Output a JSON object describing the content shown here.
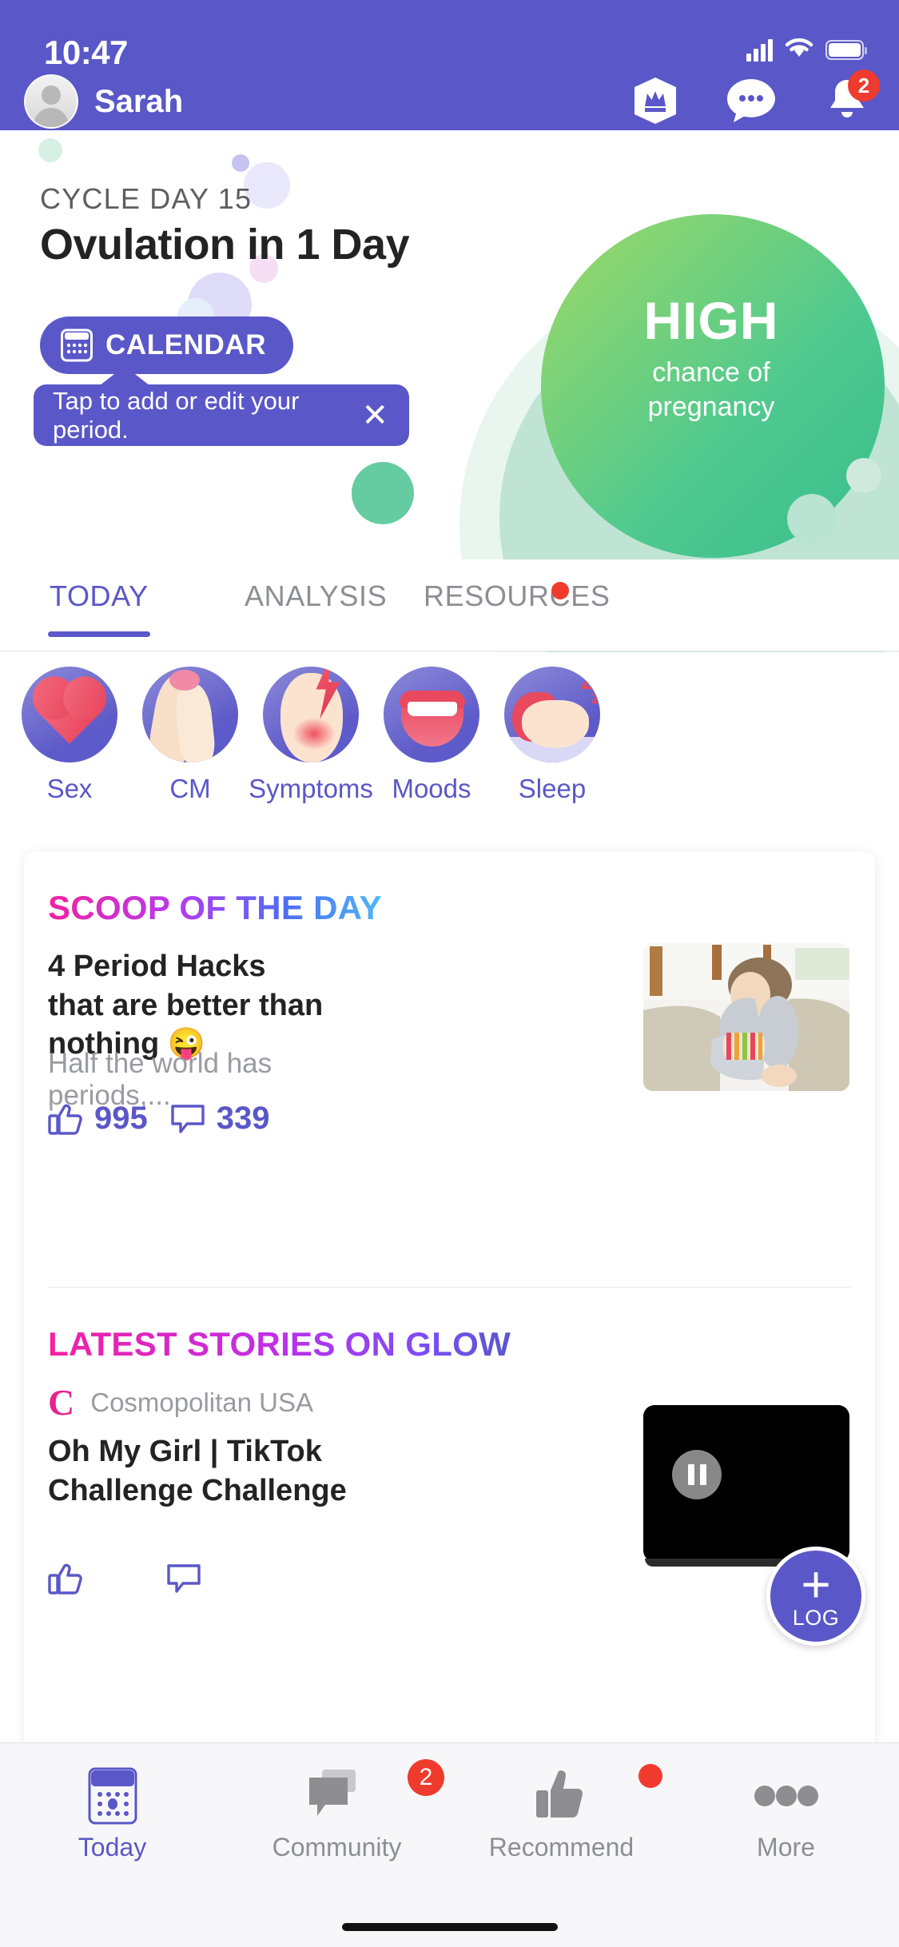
{
  "status_bar": {
    "time": "10:47"
  },
  "header": {
    "username": "Sarah",
    "icons": [
      {
        "name": "premium-crown-icon"
      },
      {
        "name": "messages-icon"
      },
      {
        "name": "notifications-bell-icon",
        "badge": "2"
      }
    ]
  },
  "hero": {
    "cycle_day": "CYCLE DAY 15",
    "ovulation": "Ovulation in 1 Day",
    "chance_level": "HIGH",
    "chance_label_line1": "chance of",
    "chance_label_line2": "pregnancy",
    "calendar_button": "CALENDAR",
    "tooltip": "Tap to add or edit your period.",
    "tooltip_close": "✕",
    "green": "#4fc98f",
    "accent": "#5a57c8"
  },
  "tabs": [
    {
      "label": "TODAY",
      "active": true
    },
    {
      "label": "ANALYSIS",
      "active": false
    },
    {
      "label": "RESOURCES",
      "active": false,
      "has_dot": true
    }
  ],
  "trackers": [
    {
      "label": "Sex",
      "icon": "heart-icon"
    },
    {
      "label": "CM",
      "icon": "cervical-mucus-icon"
    },
    {
      "label": "Symptoms",
      "icon": "symptoms-bolt-icon"
    },
    {
      "label": "Moods",
      "icon": "mouth-icon"
    },
    {
      "label": "Sleep",
      "icon": "sleeping-face-icon"
    }
  ],
  "scoop": {
    "section_title": "SCOOP OF THE DAY",
    "headline": "4 Period Hacks that are better than nothing 😜",
    "subtext": "Half the world has periods,...",
    "likes": "995",
    "comments": "339"
  },
  "latest": {
    "section_title": "LATEST STORIES ON GLOW",
    "source_logo": "C",
    "source_name": "Cosmopolitan USA",
    "headline": "Oh My Girl | TikTok Challenge Challenge",
    "likes": "",
    "comments": ""
  },
  "fab": {
    "plus": "+",
    "label": "LOG"
  },
  "bottom_nav": [
    {
      "label": "Today",
      "icon": "calendar-icon",
      "active": true
    },
    {
      "label": "Community",
      "icon": "chat-bubbles-icon",
      "badge": "2"
    },
    {
      "label": "Recommend",
      "icon": "thumbs-up-icon",
      "dot": true
    },
    {
      "label": "More",
      "icon": "ellipsis-icon"
    }
  ]
}
